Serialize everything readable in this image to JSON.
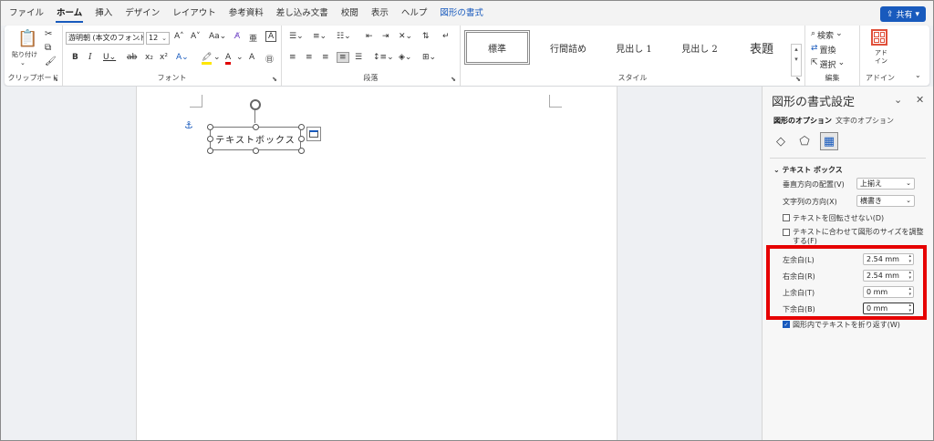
{
  "menu": {
    "tabs": [
      "ファイル",
      "ホーム",
      "挿入",
      "デザイン",
      "レイアウト",
      "参考資料",
      "差し込み文書",
      "校閲",
      "表示",
      "ヘルプ",
      "図形の書式"
    ],
    "active": "ホーム",
    "context_tab": "図形の書式",
    "share_label": "共有"
  },
  "ribbon": {
    "clipboard": {
      "paste_label": "貼り付け",
      "group_label": "クリップボード"
    },
    "font": {
      "font_name": "游明朝 (本文のフォント",
      "font_size": "12",
      "group_label": "フォント"
    },
    "paragraph": {
      "group_label": "段落"
    },
    "styles": {
      "items": [
        "標準",
        "行間詰め",
        "見出し 1",
        "見出し 2",
        "表題"
      ],
      "group_label": "スタイル"
    },
    "editing": {
      "find_label": "検索",
      "replace_label": "置換",
      "select_label": "選択",
      "group_label": "編集"
    },
    "addins": {
      "label": "アド イン",
      "group_label": "アドイン"
    }
  },
  "document": {
    "textbox_text": "テキストボックス"
  },
  "pane": {
    "title": "図形の書式設定",
    "tabs": [
      "図形のオプション",
      "文字のオプション"
    ],
    "section": "テキスト ボックス",
    "vertical_align_label": "垂直方向の配置(V)",
    "vertical_align_value": "上揃え",
    "text_direction_label": "文字列の方向(X)",
    "text_direction_value": "横書き",
    "no_rotate_label": "テキストを回転させない(D)",
    "autofit_label": "テキストに合わせて図形のサイズを調整する(F)",
    "left_margin_label": "左余白(L)",
    "left_margin_value": "2.54 mm",
    "right_margin_label": "右余白(R)",
    "right_margin_value": "2.54 mm",
    "top_margin_label": "上余白(T)",
    "top_margin_value": "0 mm",
    "bottom_margin_label": "下余白(B)",
    "bottom_margin_value": "0 mm",
    "wrap_label": "図形内でテキストを折り返す(W)",
    "wrap_checked": true
  },
  "colors": {
    "accent": "#185abd",
    "highlight_box": "#e60000"
  }
}
